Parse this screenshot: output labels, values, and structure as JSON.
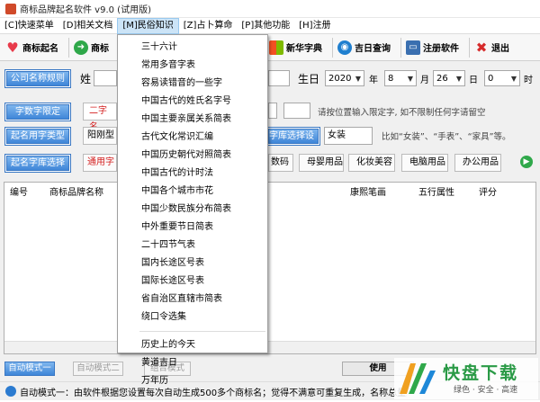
{
  "window": {
    "title": "商标品牌起名软件 v9.0 (试用版)"
  },
  "menubar": {
    "items": [
      "[C]快速菜单",
      "[D]相关文档",
      "[M]民俗知识",
      "[Z]占卜算命",
      "[P]其他功能",
      "[H]注册"
    ]
  },
  "toolbar": {
    "items": [
      {
        "label": "商标起名",
        "icon": "heart-icon",
        "color": "#e83a4a"
      },
      {
        "label": "商标",
        "icon": "arrow-right-icon",
        "color": "#2fa84a"
      },
      {
        "label": "新华字典",
        "icon": "windows-flag-icon",
        "color": "#1e6fd0"
      },
      {
        "label": "吉日查询",
        "icon": "globe-icon",
        "color": "#1f7fcf"
      },
      {
        "label": "注册软件",
        "icon": "monitor-icon",
        "color": "#3a6fb0"
      },
      {
        "label": "退出",
        "icon": "close-icon",
        "color": "#d62b2b"
      }
    ]
  },
  "form": {
    "btn_rules": "公司名称规则",
    "surname_label": "姓",
    "birthday_label": "生日",
    "year": "2020",
    "year_unit": "年",
    "month": "8",
    "month_unit": "月",
    "day": "26",
    "day_unit": "日",
    "hour": "0",
    "hour_unit": "时",
    "btn_limit": "字数字限定",
    "two_char": "二字名",
    "limit_hint": "请按位置输入限定字, 如不限制任何字请留空",
    "btn_category": "起名用字类型",
    "yanggang": "阳刚型",
    "btn_settings": "字库选择设置",
    "category_value": "女装",
    "category_hint": "比如“女装”、“手表”、“家具”等。",
    "btn_libselect": "起名字库选择",
    "common_char": "通用字",
    "cats": [
      "数码",
      "母婴用品",
      "化妆美容",
      "电脑用品",
      "办公用品"
    ]
  },
  "table": {
    "headers": [
      "编号",
      "商标品牌名称",
      "康熙笔画",
      "五行属性",
      "评分"
    ]
  },
  "modes": {
    "auto1": "自动模式一",
    "auto2": "自动模式二",
    "combo": "组合模式",
    "use_btn": "使用"
  },
  "status": {
    "text": "自动模式一：由软件根据您设置每次自动生成500多个商标名；觉得不满意可重复生成，名称总量达到一百多万个"
  },
  "dropdown": {
    "group1": [
      "三十六计",
      "常用多音字表",
      "容易读错音的一些字",
      "中国古代的姓氏名字号",
      "中国主要亲属关系简表",
      "古代文化常识汇编",
      "中国历史朝代对照简表",
      "中国古代的计时法",
      "中国各个城市市花",
      "中国少数民族分布简表",
      "中外重要节日简表",
      "二十四节气表",
      "国内长途区号表",
      "国际长途区号表",
      "省自治区直辖市简表",
      "绕口令选集"
    ],
    "group2": [
      "历史上的今天",
      "黄道吉日",
      "万年历"
    ]
  },
  "watermark": {
    "brand": "快盘下载",
    "tagline": "绿色 · 安全 · 高速"
  }
}
